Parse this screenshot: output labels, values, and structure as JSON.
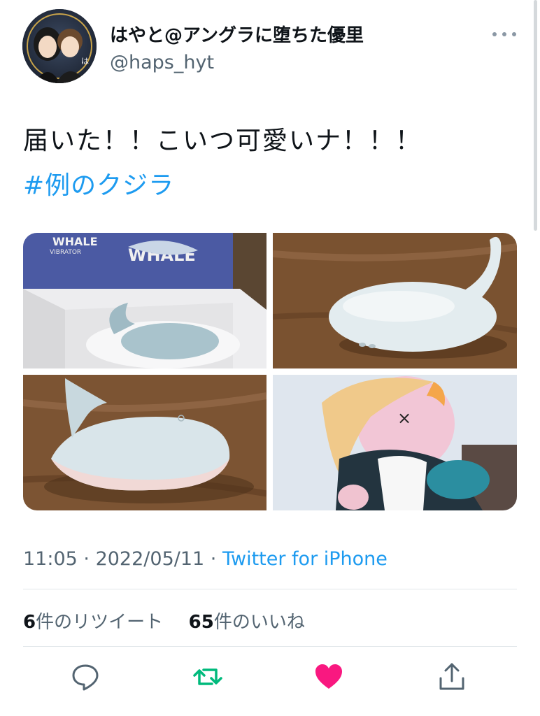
{
  "tweet": {
    "display_name": "はやと@アングラに堕ちた優里",
    "handle": "@haps_hyt",
    "text": "届いた！！こいつ可愛いナ！！！",
    "hashtag": "#例のクジラ",
    "time": "11:05",
    "date": "2022/05/11",
    "source": "Twitter for iPhone",
    "retweet_count": "6",
    "retweet_label": "件のリツイート",
    "like_count": "65",
    "like_label": "件のいいね"
  },
  "media": {
    "box_text_1": "WHALE",
    "box_text_2": "VIBRATOR",
    "box_text_3": "WHALE"
  },
  "colors": {
    "link": "#1d9bf0",
    "retweet_active": "#00ba7c",
    "like_active": "#f91880",
    "secondary_text": "#536471"
  },
  "actions": [
    "reply-icon",
    "retweet-icon",
    "like-icon",
    "share-icon"
  ]
}
